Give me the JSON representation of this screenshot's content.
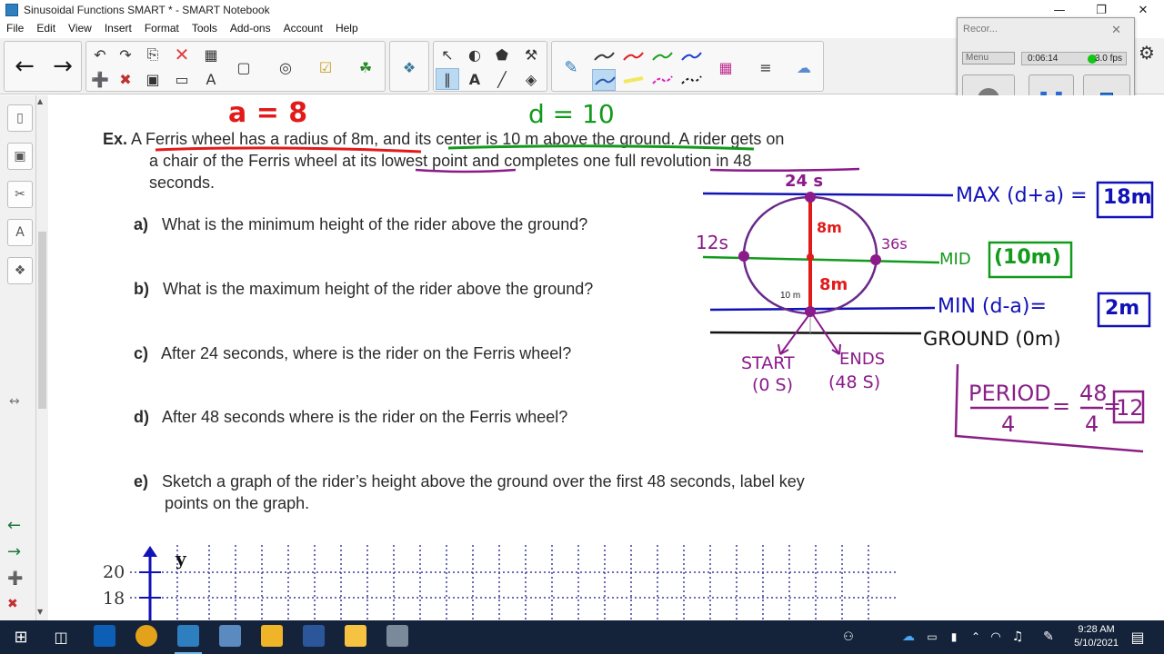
{
  "window": {
    "title": "Sinusoidal Functions SMART * - SMART Notebook",
    "minimize": "—",
    "maximize": "❐",
    "close": "✕"
  },
  "menu": [
    "File",
    "Edit",
    "View",
    "Insert",
    "Format",
    "Tools",
    "Add-ons",
    "Account",
    "Help"
  ],
  "recorder": {
    "title": "Recor...",
    "menu_label": "Menu",
    "elapsed": "0:06:14",
    "fps": "3.0 fps"
  },
  "problem": {
    "label": "Ex.",
    "line1": "A Ferris wheel has a radius of 8m, and its center is 10 m above the ground.  A rider gets on",
    "line2": "a chair of the Ferris wheel at its lowest point and completes one full revolution in 48",
    "line3": "seconds.",
    "questions": [
      {
        "letter": "a)",
        "text": "What is the minimum height of the rider above the ground?"
      },
      {
        "letter": "b)",
        "text": "What is the maximum height of the rider above the ground?"
      },
      {
        "letter": "c)",
        "text": "After 24 seconds, where is the rider on the Ferris wheel?"
      },
      {
        "letter": "d)",
        "text": "After 48 seconds where is the rider on the Ferris wheel?"
      },
      {
        "letter": "e)",
        "text": "Sketch a graph of the rider’s height above the ground over the first 48 seconds, label key"
      },
      {
        "letter": "",
        "text": "points on the graph."
      }
    ]
  },
  "annotations": {
    "a_eq": "a = 8",
    "d_eq": "d = 10",
    "t24": "24 s",
    "t12": "12s",
    "t36": "36s",
    "r_top": "8m",
    "r_bottom": "8m",
    "center_label": "10 m",
    "max_label": "MAX (d+a) =",
    "max_val": "18m",
    "mid_label": "MID",
    "mid_val": "(10m)",
    "min_label": "MIN (d-a)=",
    "min_val": "2m",
    "ground": "GROUND (0m)",
    "start": "START",
    "start_t": "(0 S)",
    "ends": "ENDS",
    "ends_t": "(48 S)",
    "period_word": "PERIOD",
    "period_div": "4",
    "frac_num": "48",
    "frac_den": "4",
    "period_val": "12"
  },
  "graph": {
    "y_label": "y",
    "ticks": [
      "20",
      "18"
    ]
  },
  "taskbar": {
    "time": "9:28 AM",
    "date": "5/10/2021"
  },
  "colors": {
    "red": "#e21a1a",
    "green": "#139a1c",
    "blue": "#1111b8",
    "purple": "#8b1a8b",
    "magenta": "#8a1f86",
    "taskbar": "#14233a"
  }
}
